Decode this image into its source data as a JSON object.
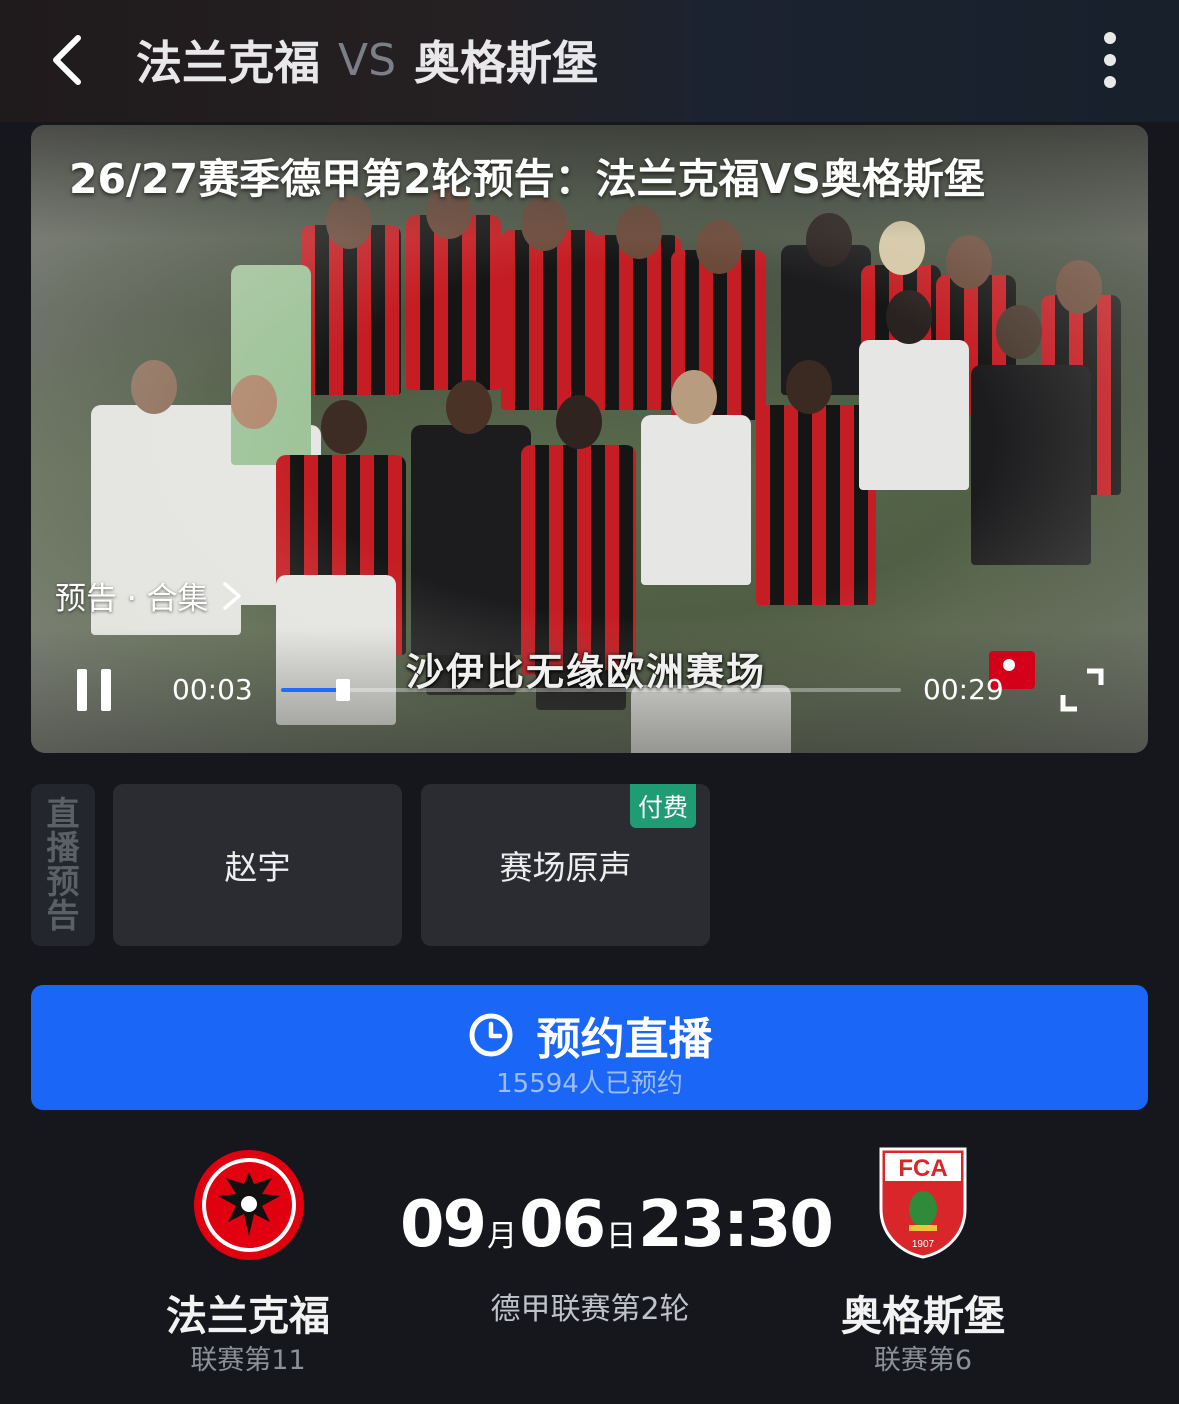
{
  "header": {
    "home_team": "法兰克福",
    "vs": "VS",
    "away_team": "奥格斯堡"
  },
  "video": {
    "title": "26/27赛季德甲第2轮预告：法兰克福VS奥格斯堡",
    "collection_label": "预告 · 合集",
    "subtitle": "沙伊比无缘欧洲赛场",
    "time_current": "00:03",
    "time_total": "00:29",
    "progress": 0.1
  },
  "commentary": {
    "tag_chars": [
      "直",
      "播",
      "预",
      "告"
    ],
    "channels": [
      {
        "label": "赵宇",
        "paid": false
      },
      {
        "label": "赛场原声",
        "paid": true
      }
    ],
    "paid_label": "付费"
  },
  "reserve": {
    "label": "预约直播",
    "count_text": "15594人已预约"
  },
  "match": {
    "home": {
      "name": "法兰克福",
      "rank": "联赛第11"
    },
    "away": {
      "name": "奥格斯堡",
      "rank": "联赛第6",
      "logo_text": "FCA",
      "logo_year": "1907"
    },
    "month": "09",
    "month_unit": "月",
    "day": "06",
    "day_unit": "日",
    "time": "23:30",
    "round": "德甲联赛第2轮"
  },
  "colors": {
    "accent_blue": "#1966f7",
    "paid_green": "#1f9c73",
    "background": "#15171c"
  }
}
